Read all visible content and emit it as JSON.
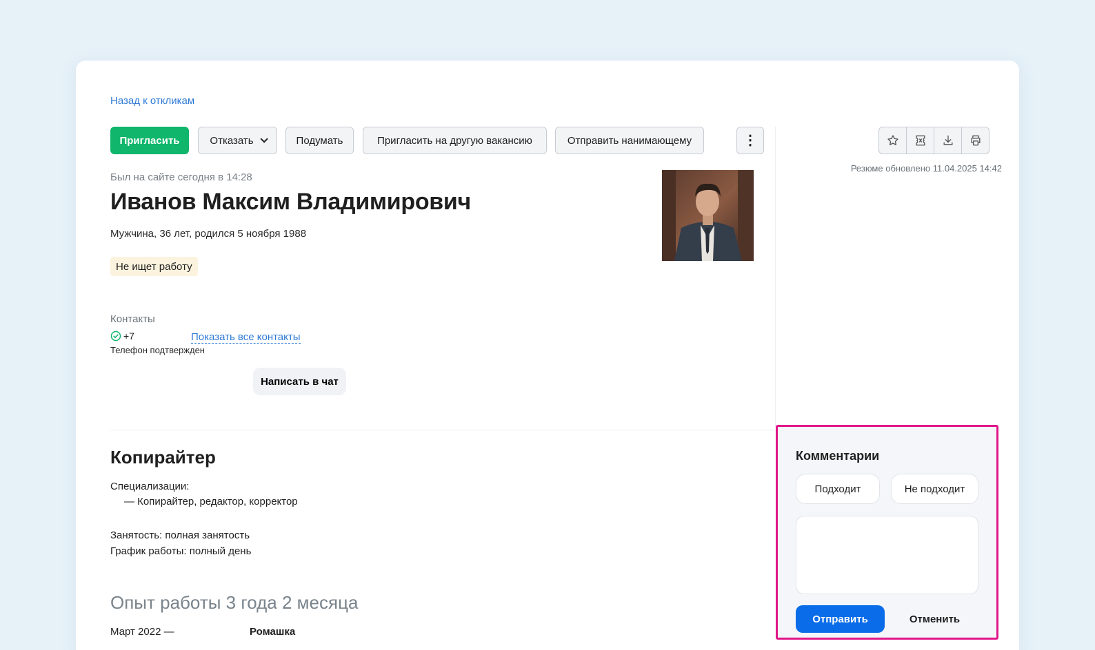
{
  "nav": {
    "back_link": "Назад к откликам"
  },
  "toolbar": {
    "invite": "Пригласить",
    "reject": "Отказать",
    "think": "Подумать",
    "invite_other": "Пригласить на другую вакансию",
    "send_to_hiring_manager": "Отправить нанимающему",
    "more": "⋮"
  },
  "side_tools": {
    "icons": [
      "star-icon",
      "coupon-icon",
      "download-icon",
      "print-icon"
    ]
  },
  "resume": {
    "updated": "Резюме обновлено 11.04.2025 14:42",
    "last_seen": "Был на сайте сегодня в 14:28",
    "name": "Иванов Максим Владимирович",
    "bio": "Мужчина, 36 лет, родился 5 ноября 1988",
    "status": "Не ищет работу",
    "contacts_label": "Контакты",
    "phone": "+7",
    "show_contacts": "Показать все контакты",
    "phone_verified": "Телефон подтвержден",
    "chat_button": "Написать в чат",
    "position": "Копирайтер",
    "specializations_label": "Специализации:",
    "specialization_item": "— Копирайтер, редактор, корректор",
    "employment": "Занятость: полная занятость",
    "schedule": "График работы: полный день",
    "experience_title": "Опыт работы 3 года 2 месяца",
    "experience_date": "Март 2022 —",
    "experience_company": "Ромашка"
  },
  "comments": {
    "title": "Комментарии",
    "fits": "Подходит",
    "not_fits": "Не подходит",
    "placeholder": "",
    "send": "Отправить",
    "cancel": "Отменить"
  },
  "colors": {
    "accent_green": "#0fb66b",
    "link_blue": "#2e7ad6",
    "send_blue": "#0a6ce8",
    "highlight_border": "#e0158a",
    "status_badge_bg": "#fbf3de"
  }
}
